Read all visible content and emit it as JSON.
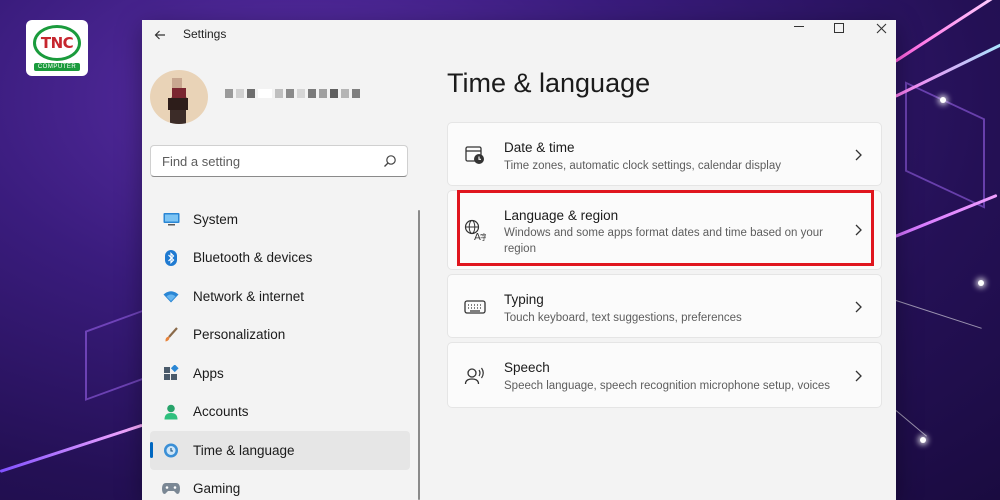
{
  "logo": {
    "mark": "TNC",
    "sub": "COMPUTER"
  },
  "window": {
    "title": "Settings",
    "controls": [
      "minimize",
      "maximize",
      "close"
    ]
  },
  "sidebar": {
    "search_placeholder": "Find a setting",
    "items": [
      {
        "label": "System",
        "icon": "monitor-icon",
        "active": false
      },
      {
        "label": "Bluetooth & devices",
        "icon": "bluetooth-icon",
        "active": false
      },
      {
        "label": "Network & internet",
        "icon": "wifi-icon",
        "active": false
      },
      {
        "label": "Personalization",
        "icon": "brush-icon",
        "active": false
      },
      {
        "label": "Apps",
        "icon": "apps-icon",
        "active": false
      },
      {
        "label": "Accounts",
        "icon": "person-icon",
        "active": false
      },
      {
        "label": "Time & language",
        "icon": "globe-clock-icon",
        "active": true
      },
      {
        "label": "Gaming",
        "icon": "gamepad-icon",
        "active": false
      }
    ]
  },
  "main": {
    "title": "Time & language",
    "cards": [
      {
        "title": "Date & time",
        "description": "Time zones, automatic clock settings, calendar display",
        "icon": "calendar-clock-icon"
      },
      {
        "title": "Language & region",
        "description": "Windows and some apps format dates and time based on your region",
        "icon": "language-icon",
        "highlighted": true
      },
      {
        "title": "Typing",
        "description": "Touch keyboard, text suggestions, preferences",
        "icon": "keyboard-icon"
      },
      {
        "title": "Speech",
        "description": "Speech language, speech recognition microphone setup, voices",
        "icon": "speech-icon"
      }
    ]
  },
  "colors": {
    "accent": "#0067c0",
    "highlight_box": "#e0161e",
    "window_bg": "#f3f3f3",
    "logo_green": "#1a9b3c",
    "logo_red": "#c6262e"
  }
}
